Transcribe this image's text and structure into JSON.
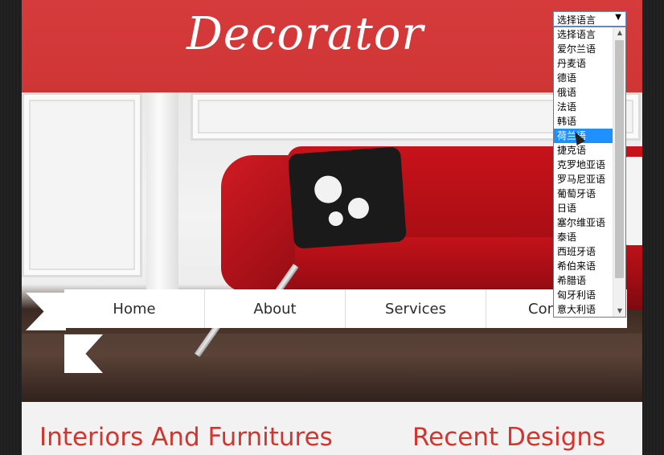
{
  "header": {
    "logo": "Decorator"
  },
  "nav": {
    "items": [
      {
        "label": "Home"
      },
      {
        "label": "About"
      },
      {
        "label": "Services"
      },
      {
        "label": "Con"
      }
    ]
  },
  "sections": {
    "left_title": "Interiors And Furnitures",
    "right_title": "Recent Designs"
  },
  "language_select": {
    "selected": "选择语言",
    "options": [
      "选择语言",
      "爱尔兰语",
      "丹麦语",
      "德语",
      "俄语",
      "法语",
      "韩语",
      "荷兰语",
      "捷克语",
      "克罗地亚语",
      "罗马尼亚语",
      "葡萄牙语",
      "日语",
      "塞尔维亚语",
      "泰语",
      "西班牙语",
      "希伯来语",
      "希腊语",
      "匈牙利语",
      "意大利语"
    ],
    "highlighted": "荷兰语"
  },
  "colors": {
    "brand_red": "#d8393a",
    "title_red": "#d2352f",
    "highlight": "#1e90ff"
  }
}
